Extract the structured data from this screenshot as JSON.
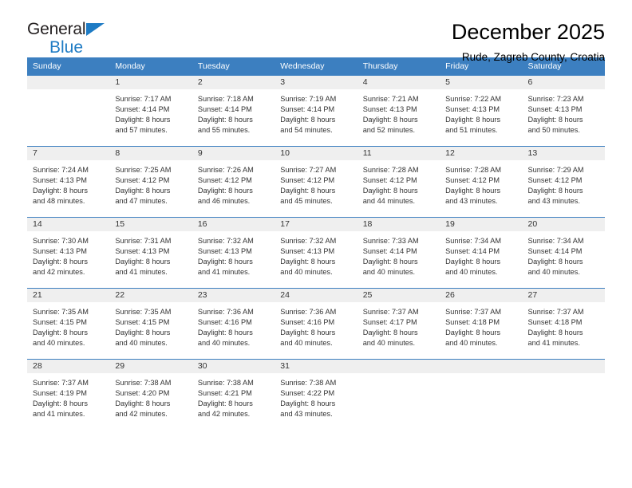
{
  "brand": {
    "name_part1": "General",
    "name_part2": "Blue",
    "accent_color": "#1e7bc4"
  },
  "header": {
    "title": "December 2025",
    "subtitle": "Rude, Zagreb County, Croatia"
  },
  "calendar": {
    "header_color": "#3c7fc0",
    "weekday_headers": [
      "Sunday",
      "Monday",
      "Tuesday",
      "Wednesday",
      "Thursday",
      "Friday",
      "Saturday"
    ],
    "weeks": [
      [
        {
          "day": "",
          "lines": []
        },
        {
          "day": "1",
          "lines": [
            "Sunrise: 7:17 AM",
            "Sunset: 4:14 PM",
            "Daylight: 8 hours",
            "and 57 minutes."
          ]
        },
        {
          "day": "2",
          "lines": [
            "Sunrise: 7:18 AM",
            "Sunset: 4:14 PM",
            "Daylight: 8 hours",
            "and 55 minutes."
          ]
        },
        {
          "day": "3",
          "lines": [
            "Sunrise: 7:19 AM",
            "Sunset: 4:14 PM",
            "Daylight: 8 hours",
            "and 54 minutes."
          ]
        },
        {
          "day": "4",
          "lines": [
            "Sunrise: 7:21 AM",
            "Sunset: 4:13 PM",
            "Daylight: 8 hours",
            "and 52 minutes."
          ]
        },
        {
          "day": "5",
          "lines": [
            "Sunrise: 7:22 AM",
            "Sunset: 4:13 PM",
            "Daylight: 8 hours",
            "and 51 minutes."
          ]
        },
        {
          "day": "6",
          "lines": [
            "Sunrise: 7:23 AM",
            "Sunset: 4:13 PM",
            "Daylight: 8 hours",
            "and 50 minutes."
          ]
        }
      ],
      [
        {
          "day": "7",
          "lines": [
            "Sunrise: 7:24 AM",
            "Sunset: 4:13 PM",
            "Daylight: 8 hours",
            "and 48 minutes."
          ]
        },
        {
          "day": "8",
          "lines": [
            "Sunrise: 7:25 AM",
            "Sunset: 4:12 PM",
            "Daylight: 8 hours",
            "and 47 minutes."
          ]
        },
        {
          "day": "9",
          "lines": [
            "Sunrise: 7:26 AM",
            "Sunset: 4:12 PM",
            "Daylight: 8 hours",
            "and 46 minutes."
          ]
        },
        {
          "day": "10",
          "lines": [
            "Sunrise: 7:27 AM",
            "Sunset: 4:12 PM",
            "Daylight: 8 hours",
            "and 45 minutes."
          ]
        },
        {
          "day": "11",
          "lines": [
            "Sunrise: 7:28 AM",
            "Sunset: 4:12 PM",
            "Daylight: 8 hours",
            "and 44 minutes."
          ]
        },
        {
          "day": "12",
          "lines": [
            "Sunrise: 7:28 AM",
            "Sunset: 4:12 PM",
            "Daylight: 8 hours",
            "and 43 minutes."
          ]
        },
        {
          "day": "13",
          "lines": [
            "Sunrise: 7:29 AM",
            "Sunset: 4:12 PM",
            "Daylight: 8 hours",
            "and 43 minutes."
          ]
        }
      ],
      [
        {
          "day": "14",
          "lines": [
            "Sunrise: 7:30 AM",
            "Sunset: 4:13 PM",
            "Daylight: 8 hours",
            "and 42 minutes."
          ]
        },
        {
          "day": "15",
          "lines": [
            "Sunrise: 7:31 AM",
            "Sunset: 4:13 PM",
            "Daylight: 8 hours",
            "and 41 minutes."
          ]
        },
        {
          "day": "16",
          "lines": [
            "Sunrise: 7:32 AM",
            "Sunset: 4:13 PM",
            "Daylight: 8 hours",
            "and 41 minutes."
          ]
        },
        {
          "day": "17",
          "lines": [
            "Sunrise: 7:32 AM",
            "Sunset: 4:13 PM",
            "Daylight: 8 hours",
            "and 40 minutes."
          ]
        },
        {
          "day": "18",
          "lines": [
            "Sunrise: 7:33 AM",
            "Sunset: 4:14 PM",
            "Daylight: 8 hours",
            "and 40 minutes."
          ]
        },
        {
          "day": "19",
          "lines": [
            "Sunrise: 7:34 AM",
            "Sunset: 4:14 PM",
            "Daylight: 8 hours",
            "and 40 minutes."
          ]
        },
        {
          "day": "20",
          "lines": [
            "Sunrise: 7:34 AM",
            "Sunset: 4:14 PM",
            "Daylight: 8 hours",
            "and 40 minutes."
          ]
        }
      ],
      [
        {
          "day": "21",
          "lines": [
            "Sunrise: 7:35 AM",
            "Sunset: 4:15 PM",
            "Daylight: 8 hours",
            "and 40 minutes."
          ]
        },
        {
          "day": "22",
          "lines": [
            "Sunrise: 7:35 AM",
            "Sunset: 4:15 PM",
            "Daylight: 8 hours",
            "and 40 minutes."
          ]
        },
        {
          "day": "23",
          "lines": [
            "Sunrise: 7:36 AM",
            "Sunset: 4:16 PM",
            "Daylight: 8 hours",
            "and 40 minutes."
          ]
        },
        {
          "day": "24",
          "lines": [
            "Sunrise: 7:36 AM",
            "Sunset: 4:16 PM",
            "Daylight: 8 hours",
            "and 40 minutes."
          ]
        },
        {
          "day": "25",
          "lines": [
            "Sunrise: 7:37 AM",
            "Sunset: 4:17 PM",
            "Daylight: 8 hours",
            "and 40 minutes."
          ]
        },
        {
          "day": "26",
          "lines": [
            "Sunrise: 7:37 AM",
            "Sunset: 4:18 PM",
            "Daylight: 8 hours",
            "and 40 minutes."
          ]
        },
        {
          "day": "27",
          "lines": [
            "Sunrise: 7:37 AM",
            "Sunset: 4:18 PM",
            "Daylight: 8 hours",
            "and 41 minutes."
          ]
        }
      ],
      [
        {
          "day": "28",
          "lines": [
            "Sunrise: 7:37 AM",
            "Sunset: 4:19 PM",
            "Daylight: 8 hours",
            "and 41 minutes."
          ]
        },
        {
          "day": "29",
          "lines": [
            "Sunrise: 7:38 AM",
            "Sunset: 4:20 PM",
            "Daylight: 8 hours",
            "and 42 minutes."
          ]
        },
        {
          "day": "30",
          "lines": [
            "Sunrise: 7:38 AM",
            "Sunset: 4:21 PM",
            "Daylight: 8 hours",
            "and 42 minutes."
          ]
        },
        {
          "day": "31",
          "lines": [
            "Sunrise: 7:38 AM",
            "Sunset: 4:22 PM",
            "Daylight: 8 hours",
            "and 43 minutes."
          ]
        },
        {
          "day": "",
          "lines": []
        },
        {
          "day": "",
          "lines": []
        },
        {
          "day": "",
          "lines": []
        }
      ]
    ]
  }
}
